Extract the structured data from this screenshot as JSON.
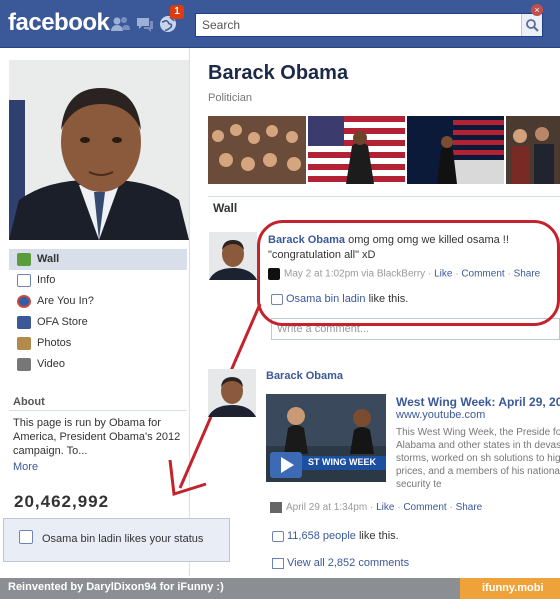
{
  "header": {
    "logo": "facebook",
    "notifications_count": "1",
    "search_placeholder": "Search"
  },
  "profile": {
    "name": "Barack Obama",
    "category": "Politician"
  },
  "nav": {
    "items": [
      {
        "label": "Wall",
        "icon": "wall-icon"
      },
      {
        "label": "Info",
        "icon": "info-icon"
      },
      {
        "label": "Are You In?",
        "icon": "campaign-icon"
      },
      {
        "label": "OFA Store",
        "icon": "store-icon"
      },
      {
        "label": "Photos",
        "icon": "photos-icon"
      },
      {
        "label": "Video",
        "icon": "video-icon"
      }
    ]
  },
  "about": {
    "heading": "About",
    "text": "This page is run by Obama for America, President Obama's 2012 campaign. To...",
    "more": "More",
    "likes_count": "20,462,992"
  },
  "toast": {
    "text": "Osama bin ladin likes your status"
  },
  "wall": {
    "heading": "Wall"
  },
  "post1": {
    "author": "Barack Obama",
    "text": "omg omg omg we killed osama !! \"congratulation all\" xD",
    "timestamp": "May 2 at 1:02pm via BlackBerry",
    "like": "Like",
    "comment": "Comment",
    "share": "Share",
    "liker": "Osama bin ladin",
    "likes_suffix": "like this.",
    "comment_placeholder": "Write a comment..."
  },
  "post2": {
    "author": "Barack Obama",
    "video_title": "West Wing Week: April 29, 20",
    "video_url": "www.youtube.com",
    "video_desc": "This West Wing Week, the Preside for Alabama and other states in th devastating storms, worked on sh solutions to high gas prices, and a members of his national security te",
    "video_banner": "ST WING WEEK",
    "timestamp": "April 29 at 1:34pm",
    "like": "Like",
    "comment": "Comment",
    "share": "Share",
    "likes_count_text": "11,658 people",
    "likes_suffix": "like this.",
    "view_comments": "View all 2,852 comments"
  },
  "footer": {
    "left": "Reinvented by DarylDixon94 for iFunny :)",
    "right": "ifunny.mobi"
  },
  "colors": {
    "brand": "#3b5998",
    "annotation_red": "#c4222c",
    "ifunny_orange": "#f0a23a"
  }
}
